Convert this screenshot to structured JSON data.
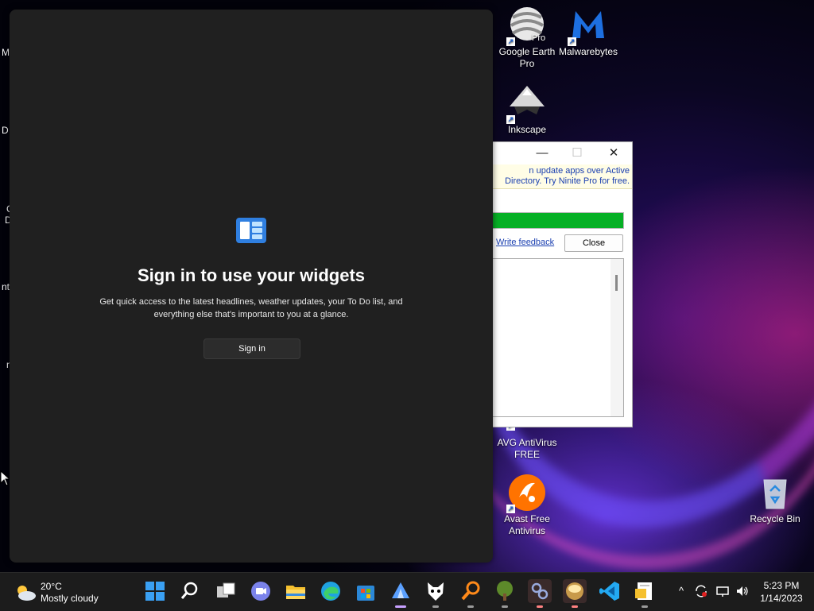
{
  "desktop": {
    "left_partial_labels": [
      "M",
      "D",
      "C",
      "D",
      "nt",
      "n"
    ],
    "icons": [
      {
        "id": "google-earth",
        "label": "Google Earth Pro",
        "badge": "Pro"
      },
      {
        "id": "malwarebytes",
        "label": "Malwarebytes"
      },
      {
        "id": "inkscape",
        "label": "Inkscape"
      },
      {
        "id": "avg",
        "label": "AVG AntiVirus FREE"
      },
      {
        "id": "avast",
        "label": "Avast Free Antivirus"
      },
      {
        "id": "recycle-bin",
        "label": "Recycle Bin"
      }
    ]
  },
  "widgets": {
    "title": "Sign in to use your widgets",
    "description": "Get quick access to the latest headlines, weather updates, your To Do list, and everything else that's important to you at a glance.",
    "signin_label": "Sign in"
  },
  "ninite": {
    "banner": "n update apps over Active Directory. Try Ninite Pro for free.",
    "feedback_label": "Write feedback",
    "close_label": "Close",
    "progress_fraction": 1.0,
    "minimize": "—",
    "maximize": "☐",
    "close_glyph": "✕"
  },
  "taskbar": {
    "weather": {
      "temp": "20°C",
      "condition": "Mostly cloudy"
    },
    "apps": [
      "start",
      "search",
      "task-view",
      "teams",
      "file-explorer",
      "edge",
      "store",
      "inkscape",
      "foobar",
      "search-everything",
      "greenshot",
      "network-tool",
      "browser",
      "vscode",
      "notepad"
    ],
    "tray_chevron": "^",
    "clock": {
      "time": "5:23 PM",
      "date": "1/14/2023"
    }
  },
  "colors": {
    "taskbar": "#1c1c1c",
    "widgets_panel": "#202020",
    "ninite_progress": "#06b025",
    "link": "#1a3fb0"
  }
}
